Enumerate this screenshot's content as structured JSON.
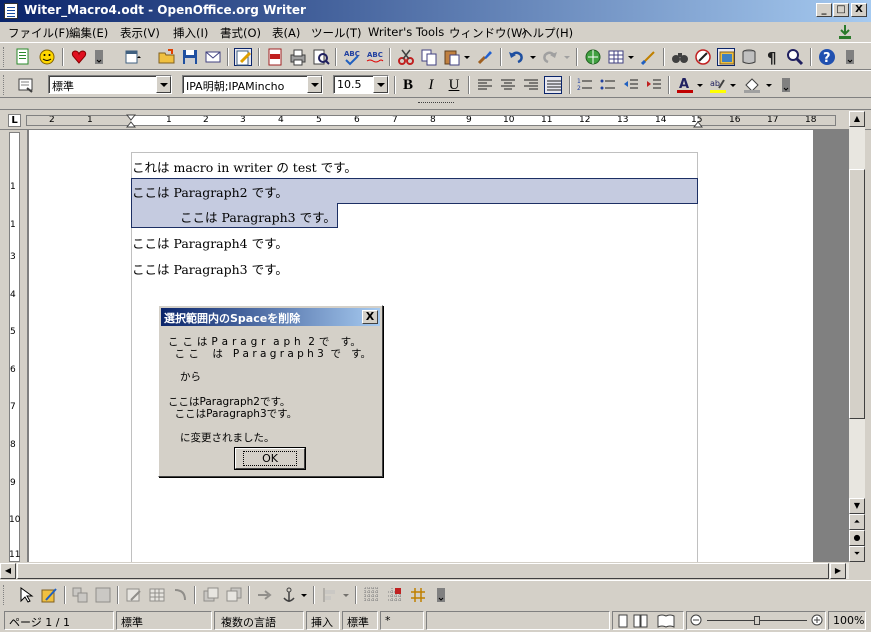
{
  "window": {
    "title": "Witer_Macro4.odt - OpenOffice.org Writer",
    "min_label": "_",
    "max_label": "□",
    "close_label": "X"
  },
  "menu": {
    "items": [
      "ファイル(F)",
      "編集(E)",
      "表示(V)",
      "挿入(I)",
      "書式(O)",
      "表(A)",
      "ツール(T)",
      "Writer's Tools",
      "ウィンドウ(W)",
      "ヘルプ(H)"
    ]
  },
  "format_toolbar": {
    "style": "標準",
    "font": "IPA明朝;IPAMincho",
    "size": "10.5",
    "bold": "B",
    "italic": "I",
    "underline": "U"
  },
  "ruler": {
    "numbers": [
      "2",
      "1",
      "1",
      "2",
      "3",
      "4",
      "5",
      "6",
      "7",
      "8",
      "9",
      "10",
      "11",
      "12",
      "13",
      "14",
      "15",
      "16",
      "17",
      "18"
    ],
    "vnumbers": [
      "1",
      "1",
      "2",
      "3",
      "4",
      "5",
      "6",
      "7",
      "8",
      "9",
      "10",
      "11"
    ],
    "tab_label": "L"
  },
  "document": {
    "paragraphs": [
      "これは macro in writer の test です。",
      "ここは Paragraph2 です。",
      "ここは Paragraph3 です。",
      "ここは Paragraph4 です。",
      "ここは Paragraph3 です。"
    ]
  },
  "dialog": {
    "title": "選択範囲内のSpaceを削除",
    "close_label": "X",
    "line1": "こ こ は P a r a g r  a p h  2 で   す。",
    "line2": "  こ こ    は   P a r a g r a p h 3  で   す。",
    "line3": "から",
    "line4": "ここはParagraph2です。",
    "line5": "  ここはParagraph3です。",
    "line6": "に変更されました。",
    "ok_label": "OK"
  },
  "status": {
    "page": "ページ 1 / 1",
    "style": "標準",
    "language": "複数の言語",
    "insert_mode": "挿入",
    "selection_mode": "標準",
    "modified": "*",
    "zoom": "100%",
    "zoom_level": 1.0
  },
  "colors": {
    "selection": "#c5cbe0",
    "title_start": "#0a246a",
    "title_end": "#a6caf0"
  }
}
